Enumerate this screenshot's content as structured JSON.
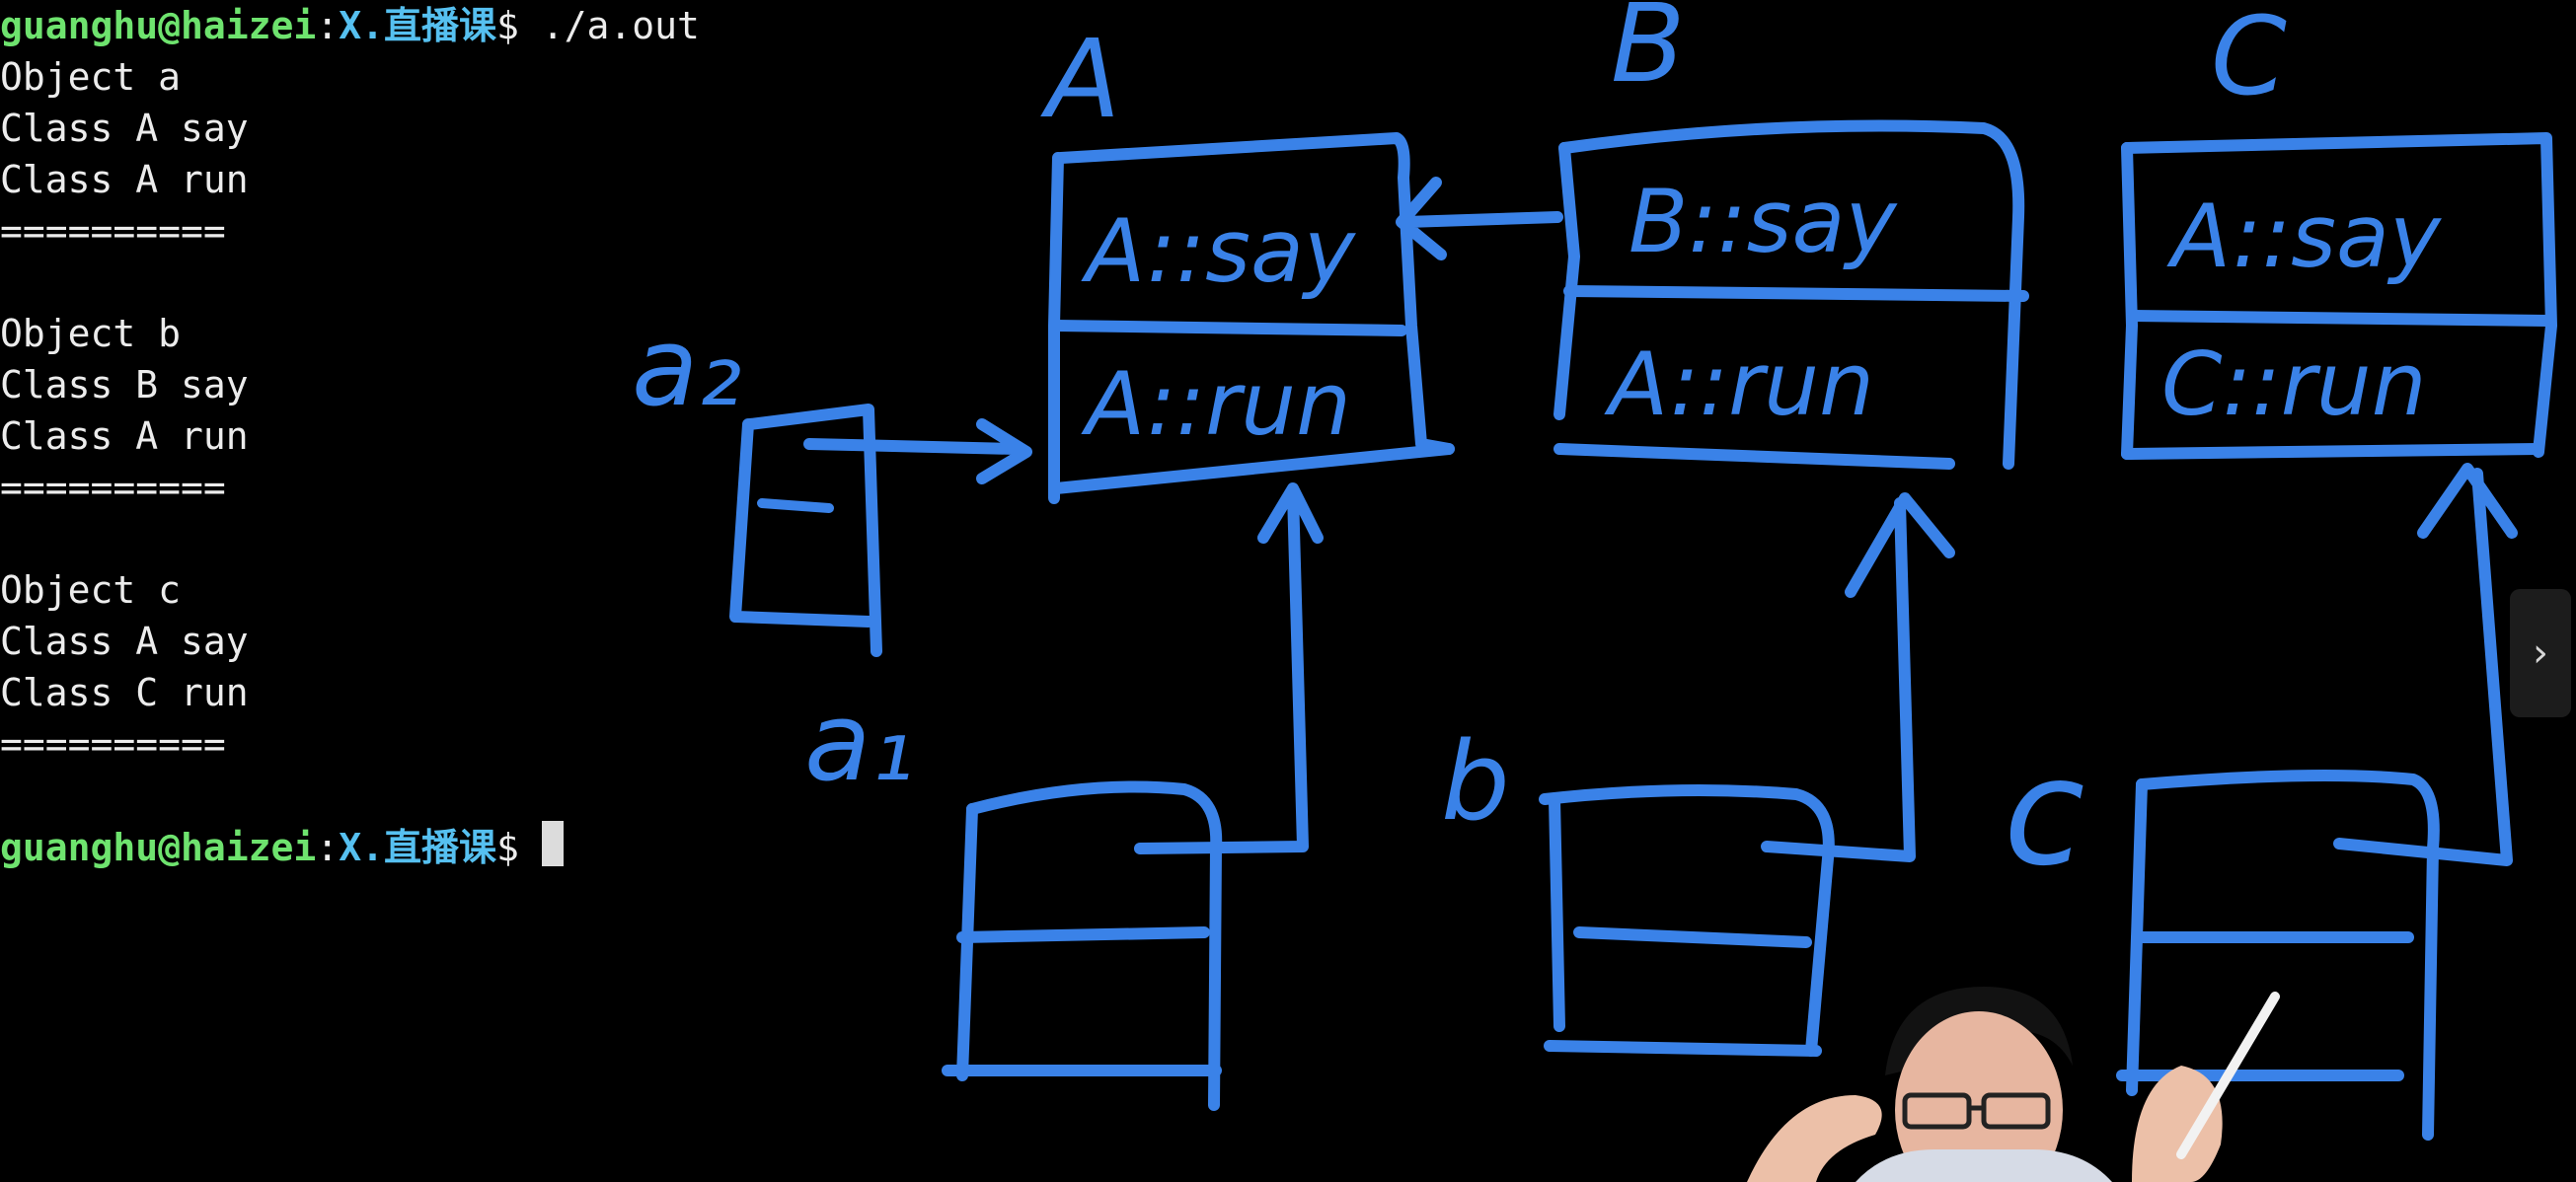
{
  "terminal": {
    "lines": [
      {
        "type": "prompt",
        "user": "guanghu@haizei",
        "path": "X.直播课",
        "dollar": "$",
        "command": " ./a.out"
      },
      {
        "type": "text",
        "text": "Object a"
      },
      {
        "type": "text",
        "text": "Class A say"
      },
      {
        "type": "text",
        "text": "Class A run"
      },
      {
        "type": "text",
        "text": "=========="
      },
      {
        "type": "text",
        "text": ""
      },
      {
        "type": "text",
        "text": "Object b"
      },
      {
        "type": "text",
        "text": "Class B say"
      },
      {
        "type": "text",
        "text": "Class A run"
      },
      {
        "type": "text",
        "text": "=========="
      },
      {
        "type": "text",
        "text": ""
      },
      {
        "type": "text",
        "text": "Object c"
      },
      {
        "type": "text",
        "text": "Class A say"
      },
      {
        "type": "text",
        "text": "Class C run"
      },
      {
        "type": "text",
        "text": "=========="
      },
      {
        "type": "text",
        "text": ""
      },
      {
        "type": "prompt",
        "user": "guanghu@haizei",
        "path": "X.直播课",
        "dollar": "$",
        "command": " "
      }
    ]
  },
  "diagram": {
    "labels": {
      "class_a": "A",
      "class_b": "B",
      "class_c": "C",
      "obj_a2": "a₂",
      "obj_a1": "a₁",
      "obj_b": "b",
      "obj_c": "c"
    },
    "vtables": {
      "a": {
        "say": "A::say",
        "run": "A::run"
      },
      "b": {
        "say": "B::say",
        "run": "A::run"
      },
      "c": {
        "say": "A::say",
        "run": "C::run"
      }
    }
  },
  "icons": {
    "next": "chevron-right-icon",
    "next_glyph": "›"
  },
  "colors": {
    "ink": "#3a82e8",
    "background": "#000000",
    "prompt_user": "#6ee36e",
    "prompt_path": "#56c0f0"
  }
}
